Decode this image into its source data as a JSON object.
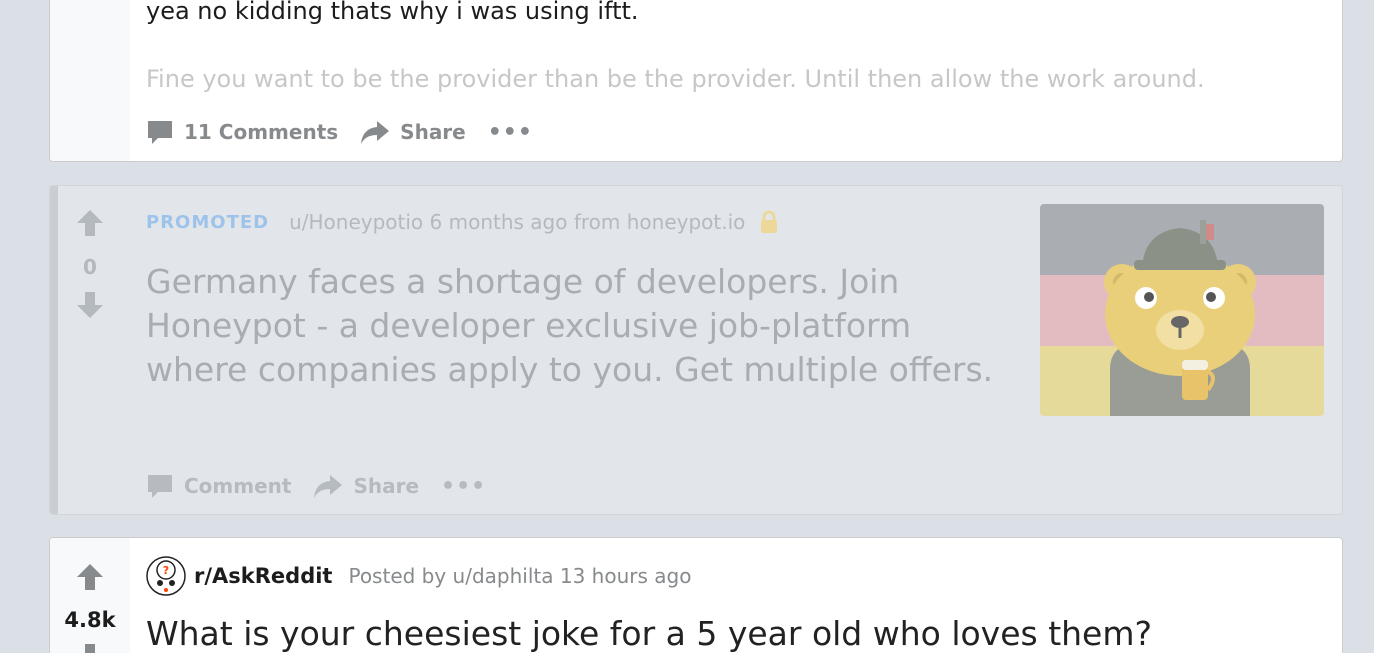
{
  "post1": {
    "body_line1": "yea no kidding thats why i was using iftt.",
    "body_line2": "Fine you want to be the provider than be the provider. Until then allow the work around.",
    "comments_label": "11 Comments",
    "share_label": "Share",
    "more_label": "•••"
  },
  "promoted": {
    "tag": "PROMOTED",
    "meta": "u/Honeypotio 6 months ago from honeypot.io",
    "score": "0",
    "title": "Germany faces a shortage of developers. Join Honeypot - a developer exclusive job-platform where companies apply to you. Get multiple offers.",
    "comment_label": "Comment",
    "share_label": "Share",
    "more_label": "•••"
  },
  "post2": {
    "subreddit": "r/AskReddit",
    "posted_by": "Posted by u/daphilta 13 hours ago",
    "score": "4.8k",
    "title": "What is your cheesiest joke for a 5 year old who loves them?"
  },
  "colors": {
    "background": "#dae0e6",
    "card": "#ffffff",
    "promoted_card": "#e2e6ea",
    "muted_text": "#878a8c",
    "promoted_tag": "#9ec3ea"
  }
}
